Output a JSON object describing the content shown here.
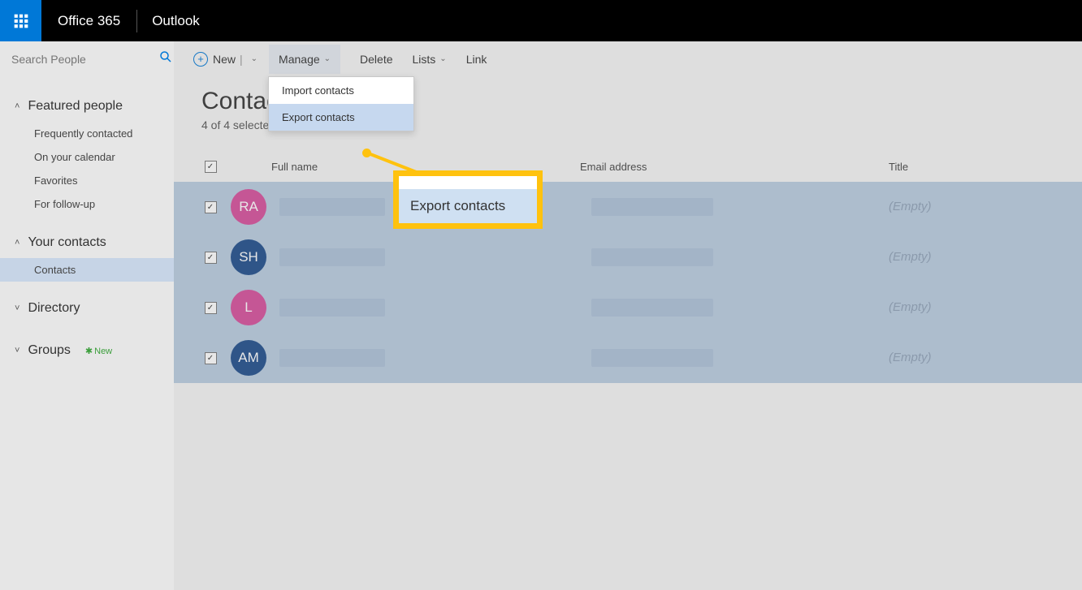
{
  "header": {
    "brand": "Office 365",
    "app": "Outlook"
  },
  "search": {
    "placeholder": "Search People"
  },
  "sidebar": {
    "groups": [
      {
        "label": "Featured people",
        "expanded": true,
        "items": [
          {
            "label": "Frequently contacted"
          },
          {
            "label": "On your calendar"
          },
          {
            "label": "Favorites"
          },
          {
            "label": "For follow-up"
          }
        ]
      },
      {
        "label": "Your contacts",
        "expanded": true,
        "items": [
          {
            "label": "Contacts",
            "selected": true
          }
        ]
      },
      {
        "label": "Directory",
        "expanded": false,
        "items": []
      },
      {
        "label": "Groups",
        "expanded": false,
        "items": [],
        "badge": "New"
      }
    ]
  },
  "toolbar": {
    "new_label": "New",
    "manage_label": "Manage",
    "delete_label": "Delete",
    "lists_label": "Lists",
    "link_label": "Link"
  },
  "manage_menu": {
    "import": "Import contacts",
    "export": "Export contacts"
  },
  "page": {
    "title": "Contacts",
    "subtitle": "4 of 4 selected"
  },
  "table": {
    "headers": {
      "name": "Full name",
      "email": "Email address",
      "title": "Title"
    },
    "empty_label": "(Empty)",
    "rows": [
      {
        "initials": "RA",
        "color": "#d64f9c"
      },
      {
        "initials": "SH",
        "color": "#1f4e8c"
      },
      {
        "initials": "L",
        "color": "#d64f9c"
      },
      {
        "initials": "AM",
        "color": "#1f4e8c"
      }
    ]
  },
  "callout": {
    "label": "Export contacts"
  }
}
